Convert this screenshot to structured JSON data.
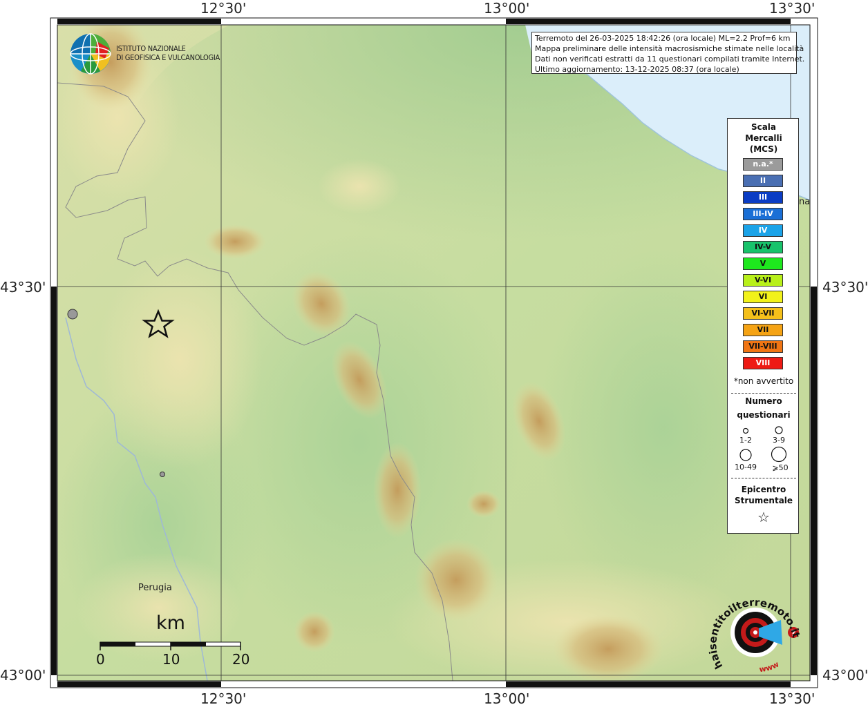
{
  "map": {
    "lon_labels_top": [
      "12°30'",
      "13°00'",
      "13°30'"
    ],
    "lon_labels_bottom": [
      "12°30'",
      "13°00'",
      "13°30'"
    ],
    "lat_labels_left": [
      "43°30'",
      "43°00'"
    ],
    "lat_labels_right": [
      "43°30'",
      "43°00'"
    ],
    "cities": [
      {
        "name": "Perugia"
      },
      {
        "name": "na"
      }
    ]
  },
  "institute": {
    "line1": "ISTITUTO NAZIONALE",
    "line2": "DI GEOFISICA E VULCANOLOGIA"
  },
  "info": {
    "line1": "Terremoto del 26-03-2025 18:42:26 (ora locale) ML=2.2 Prof=6 km",
    "line2": "Mappa preliminare delle intensità macrosismiche stimate nelle località",
    "line3": "Dati non verificati estratti da 11 questionari compilati tramite Internet.",
    "line4": "Ultimo aggiornamento: 13-12-2025 08:37 (ora locale)"
  },
  "legend": {
    "title1": "Scala",
    "title2": "Mercalli",
    "title3": "(MCS)",
    "classes": [
      {
        "label": "n.a.*",
        "color": "#9b9b9b",
        "text": "#ffffff"
      },
      {
        "label": "II",
        "color": "#4a6fb3",
        "text": "#ffffff"
      },
      {
        "label": "III",
        "color": "#0a3cc4",
        "text": "#ffffff"
      },
      {
        "label": "III-IV",
        "color": "#1a6fd6",
        "text": "#ffffff"
      },
      {
        "label": "IV",
        "color": "#1ba3e8",
        "text": "#ffffff"
      },
      {
        "label": "IV-V",
        "color": "#18c36b",
        "text": "#111111"
      },
      {
        "label": "V",
        "color": "#1ee81e",
        "text": "#111111"
      },
      {
        "label": "V-VI",
        "color": "#b8f01a",
        "text": "#111111"
      },
      {
        "label": "VI",
        "color": "#f2f21a",
        "text": "#111111"
      },
      {
        "label": "VI-VII",
        "color": "#f5c01a",
        "text": "#111111"
      },
      {
        "label": "VII",
        "color": "#f5a314",
        "text": "#111111"
      },
      {
        "label": "VII-VIII",
        "color": "#f07514",
        "text": "#111111"
      },
      {
        "label": "VIII",
        "color": "#ee1a14",
        "text": "#ffffff"
      }
    ],
    "non_felt_note": "*non avvertito",
    "quest_title1": "Numero",
    "quest_title2": "questionari",
    "quest_labels": [
      "1-2",
      "3-9",
      "10-49",
      "⩾50"
    ],
    "epi_title1": "Epicentro",
    "epi_title2": "Strumentale",
    "epi_symbol": "☆"
  },
  "scalebar": {
    "unit": "km",
    "ticks": [
      "0",
      "10",
      "20"
    ]
  },
  "logo": {
    "text": "haisentitoilterremoto.it",
    "url_text": "www"
  }
}
